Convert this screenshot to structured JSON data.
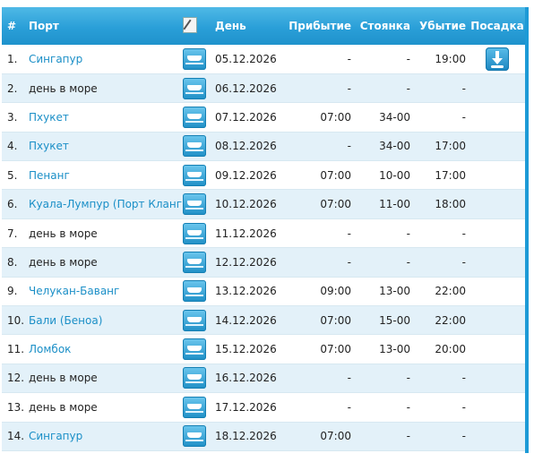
{
  "header": {
    "num": "#",
    "port": "Порт",
    "edit_icon": "pencil-icon",
    "day": "День",
    "arrival": "Прибытие",
    "stay": "Стоянка",
    "departure": "Убытие",
    "boarding": "Посадка"
  },
  "rows": [
    {
      "num": "1.",
      "port": "Сингапур",
      "link": true,
      "day": "05.12.2026",
      "arrival": "-",
      "stay": "-",
      "departure": "19:00",
      "boarding": true
    },
    {
      "num": "2.",
      "port": "день в море",
      "link": false,
      "day": "06.12.2026",
      "arrival": "-",
      "stay": "-",
      "departure": "-",
      "boarding": false
    },
    {
      "num": "3.",
      "port": "Пхукет",
      "link": true,
      "day": "07.12.2026",
      "arrival": "07:00",
      "stay": "34-00",
      "departure": "-",
      "boarding": false
    },
    {
      "num": "4.",
      "port": "Пхукет",
      "link": true,
      "day": "08.12.2026",
      "arrival": "-",
      "stay": "34-00",
      "departure": "17:00",
      "boarding": false
    },
    {
      "num": "5.",
      "port": "Пенанг",
      "link": true,
      "day": "09.12.2026",
      "arrival": "07:00",
      "stay": "10-00",
      "departure": "17:00",
      "boarding": false
    },
    {
      "num": "6.",
      "port": "Куала-Лумпур (Порт Кланг)",
      "link": true,
      "day": "10.12.2026",
      "arrival": "07:00",
      "stay": "11-00",
      "departure": "18:00",
      "boarding": false
    },
    {
      "num": "7.",
      "port": "день в море",
      "link": false,
      "day": "11.12.2026",
      "arrival": "-",
      "stay": "-",
      "departure": "-",
      "boarding": false
    },
    {
      "num": "8.",
      "port": "день в море",
      "link": false,
      "day": "12.12.2026",
      "arrival": "-",
      "stay": "-",
      "departure": "-",
      "boarding": false
    },
    {
      "num": "9.",
      "port": "Челукан-Баванг",
      "link": true,
      "day": "13.12.2026",
      "arrival": "09:00",
      "stay": "13-00",
      "departure": "22:00",
      "boarding": false
    },
    {
      "num": "10.",
      "port": "Бали (Беноа)",
      "link": true,
      "day": "14.12.2026",
      "arrival": "07:00",
      "stay": "15-00",
      "departure": "22:00",
      "boarding": false
    },
    {
      "num": "11.",
      "port": "Ломбок",
      "link": true,
      "day": "15.12.2026",
      "arrival": "07:00",
      "stay": "13-00",
      "departure": "20:00",
      "boarding": false
    },
    {
      "num": "12.",
      "port": "день в море",
      "link": false,
      "day": "16.12.2026",
      "arrival": "-",
      "stay": "-",
      "departure": "-",
      "boarding": false
    },
    {
      "num": "13.",
      "port": "день в море",
      "link": false,
      "day": "17.12.2026",
      "arrival": "-",
      "stay": "-",
      "departure": "-",
      "boarding": false
    },
    {
      "num": "14.",
      "port": "Сингапур",
      "link": true,
      "day": "18.12.2026",
      "arrival": "07:00",
      "stay": "-",
      "departure": "-",
      "boarding": false
    }
  ],
  "icons": {
    "row_icon": "ship-icon",
    "boarding_icon": "download-icon"
  },
  "colors": {
    "header_bg": "#2a9fd8",
    "link": "#1b8fc7",
    "stripe": "#e3f1f9"
  }
}
